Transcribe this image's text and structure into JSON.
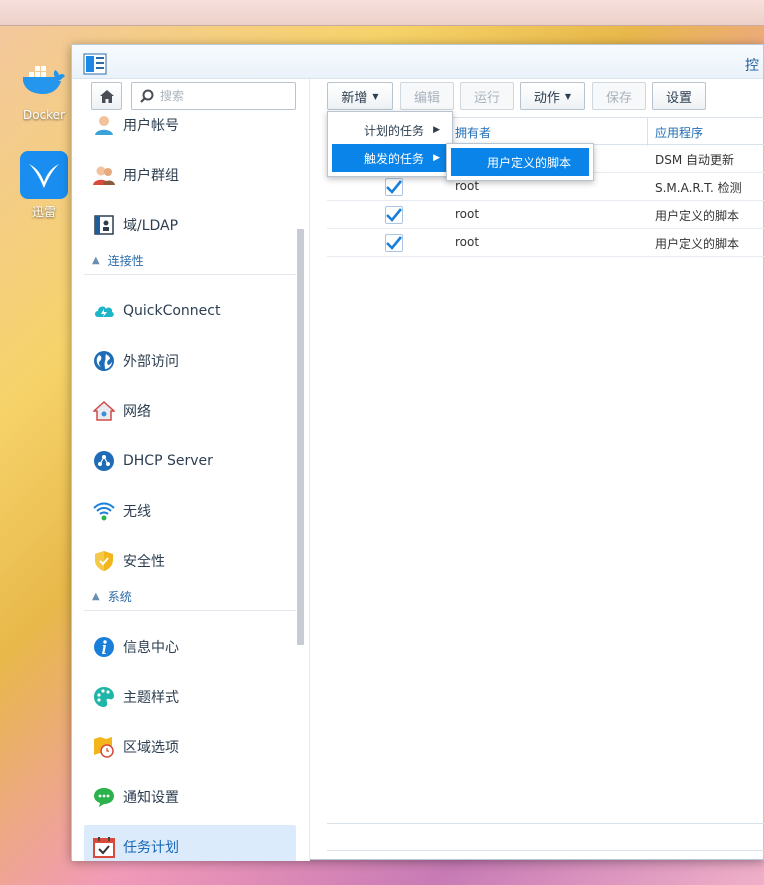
{
  "desktop": {
    "icons": [
      {
        "label": "Docker",
        "icon": "docker-icon"
      },
      {
        "label": "迅雷",
        "icon": "xunlei-bird-icon"
      }
    ]
  },
  "window": {
    "title": "控",
    "app_icon": "control-panel-icon"
  },
  "sidebar": {
    "search_placeholder": "搜索",
    "items": [
      {
        "label": "用户帐号",
        "icon": "user-icon"
      },
      {
        "label": "用户群组",
        "icon": "user-group-icon"
      },
      {
        "label": "域/LDAP",
        "icon": "domain-ldap-icon"
      },
      {
        "label": "QuickConnect",
        "icon": "quickconnect-cloud-icon"
      },
      {
        "label": "外部访问",
        "icon": "globe-icon"
      },
      {
        "label": "网络",
        "icon": "network-house-icon"
      },
      {
        "label": "DHCP Server",
        "icon": "dhcp-server-icon"
      },
      {
        "label": "无线",
        "icon": "wifi-icon"
      },
      {
        "label": "安全性",
        "icon": "shield-icon"
      },
      {
        "label": "信息中心",
        "icon": "info-icon"
      },
      {
        "label": "主题样式",
        "icon": "palette-icon"
      },
      {
        "label": "区域选项",
        "icon": "regional-map-clock-icon"
      },
      {
        "label": "通知设置",
        "icon": "chat-bubble-icon"
      },
      {
        "label": "任务计划",
        "icon": "calendar-check-icon"
      }
    ],
    "sections": {
      "connectivity": "连接性",
      "system": "系统"
    },
    "active_item": "任务计划"
  },
  "toolbar": {
    "create": "新增",
    "edit": "编辑",
    "run": "运行",
    "action": "动作",
    "save": "保存",
    "settings": "设置"
  },
  "create_menu": {
    "items": [
      "计划的任务",
      "触发的任务"
    ],
    "highlighted": "触发的任务"
  },
  "submenu": {
    "items": [
      "用户定义的脚本"
    ]
  },
  "grid": {
    "columns": [
      "拥有者",
      "应用程序"
    ],
    "rows": [
      {
        "enabled": true,
        "owner": "",
        "app": "DSM 自动更新"
      },
      {
        "enabled": true,
        "owner": "root",
        "app": "S.M.A.R.T. 检测"
      },
      {
        "enabled": true,
        "owner": "root",
        "app": "用户定义的脚本"
      },
      {
        "enabled": true,
        "owner": "root",
        "app": "用户定义的脚本"
      }
    ]
  },
  "colors": {
    "accent": "#0a84e8",
    "active_nav_bg": "#dcebfb",
    "link_blue": "#1f6db6",
    "check_blue": "#1a7fd9"
  }
}
